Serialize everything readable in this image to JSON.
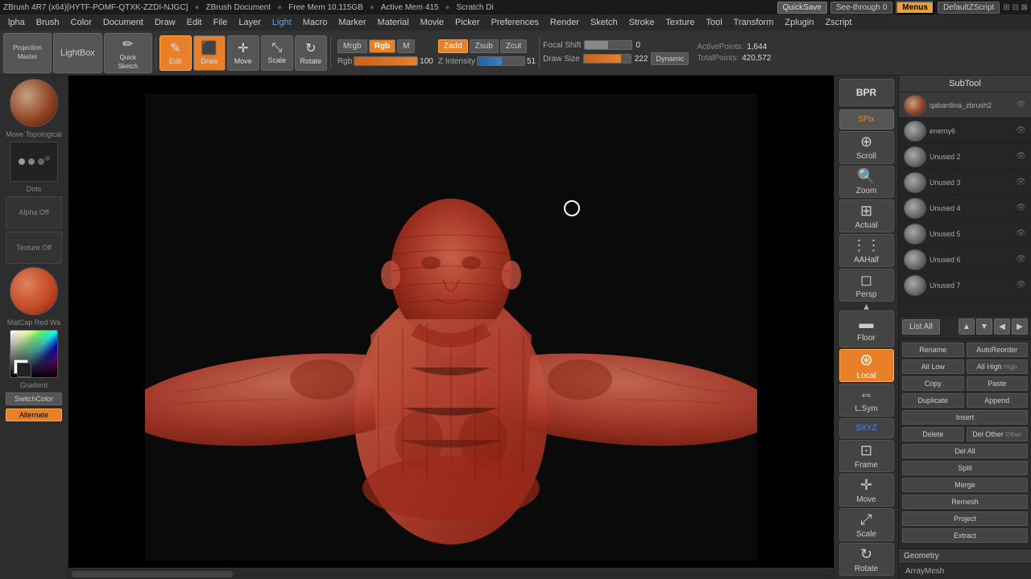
{
  "app": {
    "title": "ZBrush 4R7 (x64)[HYTF-POMF-QTXK-ZZDI-NJGC]",
    "document": "ZBrush Document",
    "free_mem": "Free Mem 10.115GB",
    "active_mem": "Active Mem 415",
    "scratch": "Scratch Di"
  },
  "topbar": {
    "quicksave_label": "QuickSave",
    "seethrough_label": "See-through",
    "seethrough_value": "0",
    "menus_label": "Menus",
    "default_script_label": "DefaultZScript"
  },
  "menu": {
    "items": [
      "lpha",
      "Brush",
      "Color",
      "Document",
      "Draw",
      "Edit",
      "File",
      "Layer",
      "Light",
      "Macro",
      "Marker",
      "Material",
      "Movie",
      "Picker",
      "Preferences",
      "Render",
      "Sketch",
      "Stroke",
      "Texture",
      "Tool",
      "Transform",
      "Zplugin",
      "Zscript"
    ]
  },
  "toolbar": {
    "projection_master_label": "Projection\nMaster",
    "lightbox_label": "LightBox",
    "quick_sketch_label": "Quick\nSketch",
    "edit_label": "Edit",
    "draw_label": "Draw",
    "move_label": "Move",
    "scale_label": "Scale",
    "rotate_label": "Rotate",
    "mrgb_label": "Mrgb",
    "rgb_label": "Rgb",
    "m_label": "M",
    "zadd_label": "Zadd",
    "zsub_label": "Zsub",
    "zcut_label": "Zcut",
    "focal_shift_label": "Focal Shift",
    "focal_shift_value": "0",
    "rgb_intensity_label": "Rgb Intensity",
    "rgb_intensity_value": "100",
    "z_intensity_label": "Z Intensity",
    "z_intensity_value": "51",
    "draw_size_label": "Draw Size",
    "draw_size_value": "222",
    "dynamic_label": "Dynamic",
    "active_points_label": "ActivePoints:",
    "active_points_value": "1,644",
    "total_points_label": "TotalPoints:",
    "total_points_value": "420,572"
  },
  "left_panel": {
    "move_topological_label": "Move Topological",
    "dots_label": "Dots",
    "alpha_off_label": "Alpha Off",
    "texture_off_label": "Texture Off",
    "matcap_label": "MatCap Red Wa",
    "gradient_label": "Gradient",
    "switch_color_label": "SwitchColor",
    "alternate_label": "Alternate"
  },
  "right_nav": {
    "bpr_label": "BPR",
    "spix_label": "SPix",
    "scroll_label": "Scroll",
    "zoom_label": "Zoom",
    "actual_label": "Actual",
    "aahalf_label": "AAHalf",
    "persp_label": "Persp",
    "floor_label": "Floor",
    "local_label": "Local",
    "lsym_label": "L.Sym",
    "xyz_label": "SXYZ",
    "frame_label": "Frame",
    "move_label": "Move",
    "scale_label": "Scale",
    "rotate_label": "Rotate"
  },
  "subtool": {
    "header": "SubTool",
    "items": [
      {
        "name": "qabardina_zbrush2",
        "active": true
      },
      {
        "name": "enemy6",
        "active": false
      },
      {
        "name": "Unused 2",
        "active": false
      },
      {
        "name": "Unused 3",
        "active": false
      },
      {
        "name": "Unused 4",
        "active": false
      },
      {
        "name": "Unused 5",
        "active": false
      },
      {
        "name": "Unused 6",
        "active": false
      },
      {
        "name": "Unused 7",
        "active": false
      }
    ],
    "list_all_label": "List All",
    "actions": {
      "rename_label": "Rename",
      "auto_reorder_label": "AutoReorder",
      "all_low_label": "All Low",
      "all_high_label": "All High",
      "copy_label": "Copy",
      "paste_label": "Paste",
      "duplicate_label": "Duplicate",
      "append_label": "Append",
      "insert_label": "Insert",
      "del_other_label": "Del Other",
      "delete_label": "Delete",
      "del_all_label": "Del All",
      "split_label": "Split",
      "merge_label": "Merge",
      "remesh_label": "Remesh",
      "project_label": "Project",
      "extract_label": "Extract"
    },
    "high_label": "High",
    "other_label": "Other",
    "geometry_label": "Geometry",
    "arraymesh_label": "ArrayMesh"
  }
}
